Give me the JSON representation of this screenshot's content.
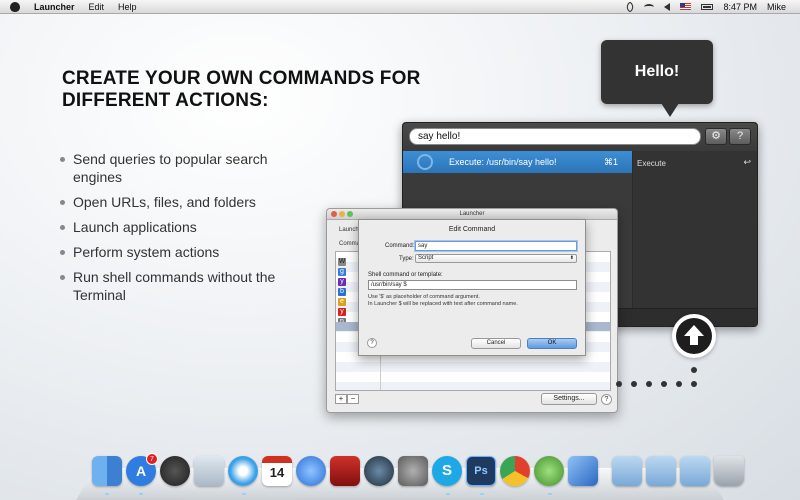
{
  "menubar": {
    "app_name": "Launcher",
    "menus": [
      "Edit",
      "Help"
    ],
    "time": "8:47 PM",
    "user": "Mike"
  },
  "headline": "CREATE YOUR OWN COMMANDS FOR DIFFERENT ACTIONS:",
  "features": [
    "Send queries to popular search engines",
    "Open URLs, files, and folders",
    "Launch applications",
    "Perform system actions",
    "Run shell commands without the Terminal"
  ],
  "bubble": {
    "text": "Hello!"
  },
  "launcher": {
    "query": "say  hello!",
    "gear_icon": "gear-icon",
    "help_label": "?",
    "result_text": "Execute: /usr/bin/say  hello!",
    "result_shortcut": "⌘1",
    "side_label": "Execute",
    "return_glyph": "↩"
  },
  "prefs": {
    "title": "Launcher",
    "tab_label": "Launch",
    "commands_label": "Comma",
    "add_label": "+",
    "remove_label": "−",
    "settings_label": "Settings...",
    "help_label": "?"
  },
  "sheet": {
    "title": "Edit Command",
    "command_label": "Command:",
    "command_value": "say",
    "type_label": "Type:",
    "type_value": "Script",
    "template_label": "Shell command or template:",
    "template_value": "/usr/bin/say $",
    "note_line1": "Use '$' as placeholder of command argument.",
    "note_line2": "In Launcher $ will be replaced with text after command name.",
    "cancel_label": "Cancel",
    "ok_label": "OK",
    "help_label": "?"
  },
  "dock": {
    "appstore_badge": "7",
    "calendar_day": "14",
    "photoshop_label": "Ps",
    "colors": {
      "finder": "#4a8fe0",
      "appstore": "#2f7de0",
      "dashboard": "#2a2a2a",
      "preview": "#c8d4e0",
      "safari": "#3aa0e8",
      "calendar": "#ffffff",
      "itunes": "#2b6fd6",
      "photobooth": "#b3201c",
      "timemachine": "#2a3a4a",
      "prefs": "#7a7a7a",
      "skype": "#1fa8e6",
      "photoshop": "#1e3a5f",
      "chrome": "#e0412f",
      "adium": "#5fb041",
      "xcode": "#3c78d0",
      "apps_folder": "#8fb8e0",
      "docs_folder": "#8fb8e0",
      "downloads_folder": "#8fb8e0",
      "trash": "#b8bec4"
    }
  }
}
